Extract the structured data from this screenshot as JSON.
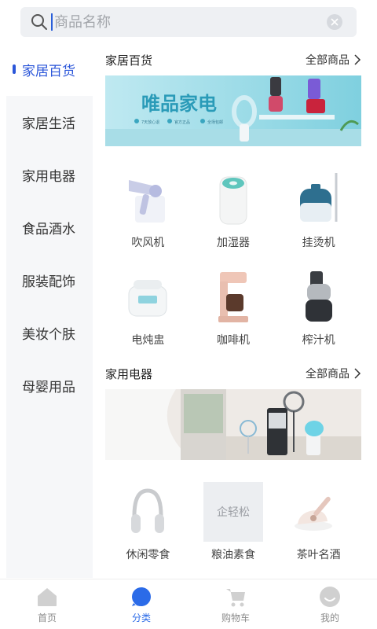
{
  "search": {
    "placeholder": "商品名称"
  },
  "sidebar": {
    "items": [
      {
        "label": "家居百货",
        "active": true
      },
      {
        "label": "家居生活"
      },
      {
        "label": "家用电器"
      },
      {
        "label": "食品酒水"
      },
      {
        "label": "服装配饰"
      },
      {
        "label": "美妆个肤"
      },
      {
        "label": "母婴用品"
      }
    ]
  },
  "sections": [
    {
      "title": "家居百货",
      "more": "全部商品",
      "banner": {
        "headline": "唯品家电",
        "notes": [
          "7天放心退",
          "官方正品",
          "全场包邮"
        ]
      },
      "products": [
        {
          "label": "吹风机",
          "icon": "hair-dryer"
        },
        {
          "label": "加湿器",
          "icon": "humidifier"
        },
        {
          "label": "挂烫机",
          "icon": "garment-steamer"
        },
        {
          "label": "电炖盅",
          "icon": "slow-cooker"
        },
        {
          "label": "咖啡机",
          "icon": "coffee-machine"
        },
        {
          "label": "榨汁机",
          "icon": "juicer"
        }
      ]
    },
    {
      "title": "家用电器",
      "more": "全部商品",
      "products": [
        {
          "label": "休闲零食",
          "icon": "headphones"
        },
        {
          "label": "粮油素食",
          "icon": "placeholder-logo",
          "placeholder_text": "企轻松"
        },
        {
          "label": "茶叶名酒",
          "icon": "mite-vacuum"
        }
      ]
    }
  ],
  "tabbar": {
    "items": [
      {
        "label": "首页",
        "active": false
      },
      {
        "label": "分类",
        "active": true
      },
      {
        "label": "购物车",
        "active": false
      },
      {
        "label": "我的",
        "active": false
      }
    ]
  },
  "colors": {
    "accent": "#2b56d9",
    "sidebar_bg": "#f6f7f9",
    "tab_active": "#2b6be8"
  }
}
